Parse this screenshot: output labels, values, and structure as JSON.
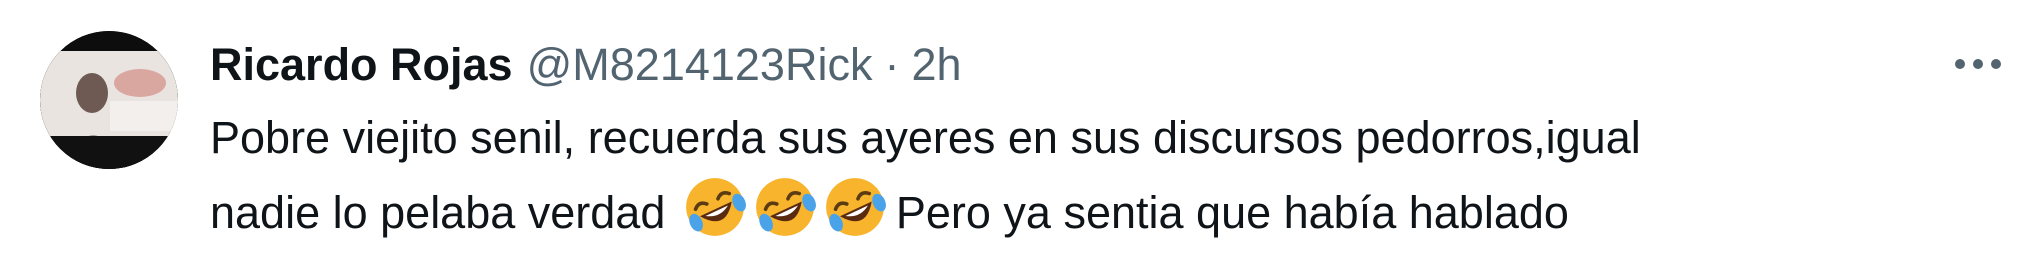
{
  "tweet": {
    "author_name": "Ricardo Rojas",
    "author_handle": "@M8214123Rick",
    "separator": "·",
    "time": "2h",
    "text_line1": "Pobre viejito senil, recuerda sus ayeres en sus discursos pedorros,igual",
    "text_line2_before": "nadie lo pelaba verdad ",
    "text_line2_after": "Pero ya sentia que había hablado",
    "emojis": [
      "rolling-on-floor-laughing",
      "rolling-on-floor-laughing",
      "rolling-on-floor-laughing"
    ]
  },
  "colors": {
    "text_primary": "#0f1419",
    "text_secondary": "#536471",
    "emoji_face": "#f7b42c"
  }
}
